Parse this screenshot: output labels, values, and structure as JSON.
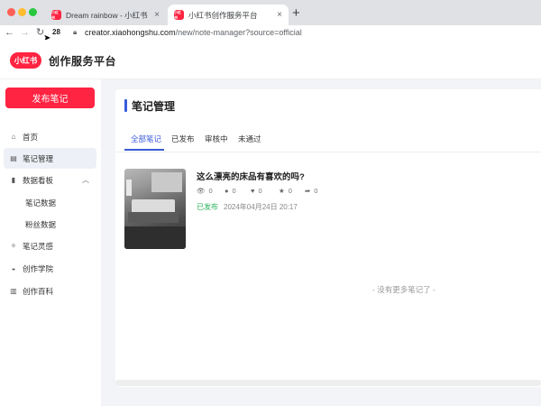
{
  "browser": {
    "tabs": [
      {
        "title": "Dream rainbow - 小红书",
        "active": false
      },
      {
        "title": "小红书创作服务平台",
        "active": true
      }
    ],
    "favicon_text": "小红书",
    "new_tab_label": "+",
    "close_label": "×",
    "reload_count": "28",
    "url_host": "creator.xiaohongshu.com",
    "url_path": "/new/note-manager?source=official"
  },
  "header": {
    "logo_text": "小红书",
    "brand": "创作服务平台"
  },
  "sidebar": {
    "publish_label": "发布笔记",
    "items": [
      {
        "label": "首页",
        "icon": "home-icon",
        "glyph": "⌂"
      },
      {
        "label": "笔记管理",
        "icon": "note-icon",
        "glyph": "▤"
      },
      {
        "label": "数据看板",
        "icon": "chart-icon",
        "glyph": "▮"
      },
      {
        "label": "笔记数据"
      },
      {
        "label": "粉丝数据"
      },
      {
        "label": "笔记灵感",
        "icon": "bulb-icon",
        "glyph": "✧"
      },
      {
        "label": "创作学院",
        "icon": "academy-icon",
        "glyph": "◒"
      },
      {
        "label": "创作百科",
        "icon": "book-icon",
        "glyph": "▥"
      }
    ]
  },
  "main": {
    "page_title": "笔记管理",
    "tabs": [
      {
        "label": "全部笔记",
        "active": true
      },
      {
        "label": "已发布",
        "active": false
      },
      {
        "label": "审核中",
        "active": false
      },
      {
        "label": "未通过",
        "active": false
      }
    ],
    "notes": [
      {
        "title": "这么漂亮的床品有喜欢的吗?",
        "views": "0",
        "comments": "0",
        "likes": "0",
        "collects": "0",
        "shares": "0",
        "status": "已发布",
        "time": "2024年04月24日 20:17"
      }
    ],
    "no_more_text": "- 没有更多笔记了 -"
  },
  "colors": {
    "brand_red": "#ff2442",
    "accent_blue": "#3b5bdb",
    "published_green": "#2db55d"
  }
}
